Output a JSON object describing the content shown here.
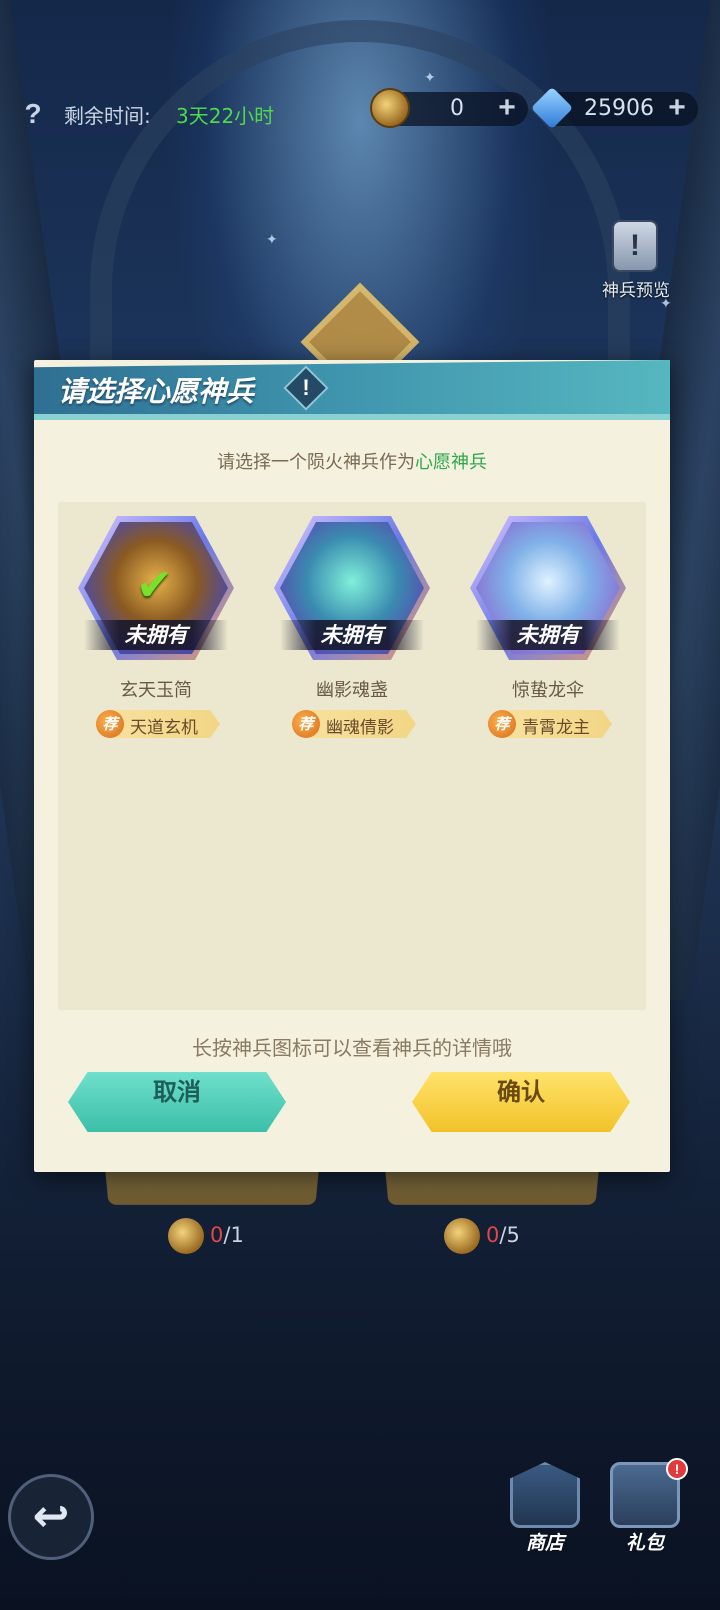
{
  "top_bar": {
    "help_icon": "?",
    "remaining_label": "剩余时间:",
    "remaining_value": "3天22小时",
    "resource1_value": "0",
    "resource2_value": "25906",
    "plus_symbol": "+"
  },
  "preview": {
    "label": "神兵预览",
    "icon": "!"
  },
  "background": {
    "counts": [
      {
        "current": "0",
        "total": "/1"
      },
      {
        "current": "0",
        "total": "/5"
      }
    ]
  },
  "dialog": {
    "title": "请选择心愿神兵",
    "title_icon": "!",
    "subtitle_prefix": "请选择一个陨火神兵作为",
    "subtitle_highlight": "心愿神兵",
    "items": [
      {
        "name": "玄天玉简",
        "status": "未拥有",
        "rec_badge": "荐",
        "rec_text": "天道玄机",
        "selected": true
      },
      {
        "name": "幽影魂盏",
        "status": "未拥有",
        "rec_badge": "荐",
        "rec_text": "幽魂倩影",
        "selected": false
      },
      {
        "name": "惊蛰龙伞",
        "status": "未拥有",
        "rec_badge": "荐",
        "rec_text": "青霄龙主",
        "selected": false
      }
    ],
    "check_mark": "✔",
    "hint": "长按神兵图标可以查看神兵的详情哦",
    "cancel_label": "取消",
    "confirm_label": "确认"
  },
  "bottom_nav": {
    "back_icon": "↩",
    "shop_label": "商店",
    "gift_label": "礼包",
    "gift_badge": "!"
  },
  "colors": {
    "accent_green": "#4fd84a",
    "highlight_green": "#2ea84a",
    "count_red": "#e04848",
    "cancel_teal": "#3bbfa8",
    "confirm_yellow": "#f2c22a"
  }
}
